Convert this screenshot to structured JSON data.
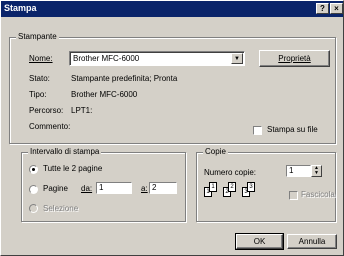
{
  "window": {
    "title": "Stampa",
    "help_label": "?",
    "close_label": "×"
  },
  "printer": {
    "group_label": "Stampante",
    "name_label": "Nome:",
    "name_value": "Brother MFC-6000",
    "properties_label": "Proprietà",
    "status_label": "Stato:",
    "status_value": "Stampante predefinita; Pronta",
    "type_label": "Tipo:",
    "type_value": "Brother MFC-6000",
    "path_label": "Percorso:",
    "path_value": "LPT1:",
    "comment_label": "Commento:",
    "print_to_file_label": "Stampa su file"
  },
  "range": {
    "group_label": "Intervallo di stampa",
    "all_label": "Tutte le 2 pagine",
    "pages_label": "Pagine",
    "from_label": "da:",
    "from_value": "1",
    "to_label": "a:",
    "to_value": "2",
    "selection_label": "Selezione"
  },
  "copies": {
    "group_label": "Copie",
    "count_label": "Numero copie:",
    "count_value": "1",
    "collate_label": "Fascicola",
    "preview_pages": [
      "1",
      "1",
      "2",
      "2",
      "3",
      "3"
    ]
  },
  "buttons": {
    "ok_label": "OK",
    "cancel_label": "Annulla"
  }
}
